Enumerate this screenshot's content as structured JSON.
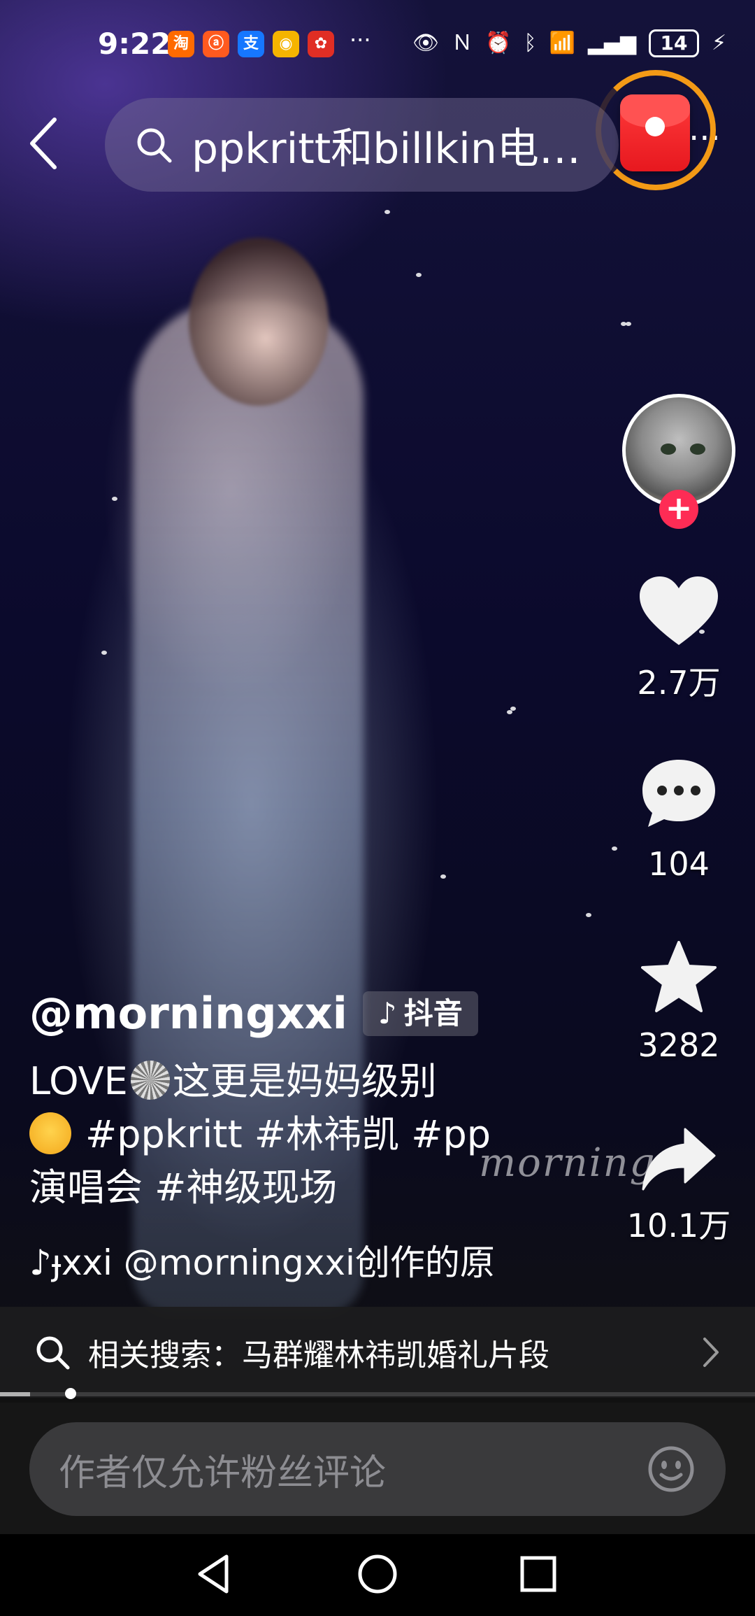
{
  "status_bar": {
    "time": "9:22",
    "apps": [
      {
        "icon": "taobao-icon",
        "glyph": "淘",
        "color": "#ff6a00"
      },
      {
        "icon": "1688-icon",
        "glyph": "ⓐ",
        "color": "#ff5a1f"
      },
      {
        "icon": "alipay-icon",
        "glyph": "支",
        "color": "#1677ff"
      },
      {
        "icon": "weibo-icon",
        "glyph": "◉",
        "color": "#f5b400"
      },
      {
        "icon": "pinduoduo-icon",
        "glyph": "✿",
        "color": "#e02e24"
      }
    ],
    "more": "···",
    "battery": "14"
  },
  "header": {
    "search_query": "ppkritt和billkin电…",
    "more": "···"
  },
  "actions": {
    "likes": "2.7万",
    "comments": "104",
    "favorites": "3282",
    "shares": "10.1万"
  },
  "video": {
    "watermark": "morning",
    "progress": 0.04
  },
  "caption": {
    "username": "@morningxxi",
    "badge": "抖音",
    "line1_a": "LOVE",
    "line1_b": "这更是妈妈级别",
    "line2": "#ppkritt #林祎凯 #pp",
    "line3": "演唱会 #神级现场",
    "music": "ɟxxi    @morningxxi创作的原"
  },
  "related_search": {
    "label": "相关搜索：马群耀林祎凯婚礼片段"
  },
  "comment_box": {
    "placeholder": "作者仅允许粉丝评论"
  }
}
